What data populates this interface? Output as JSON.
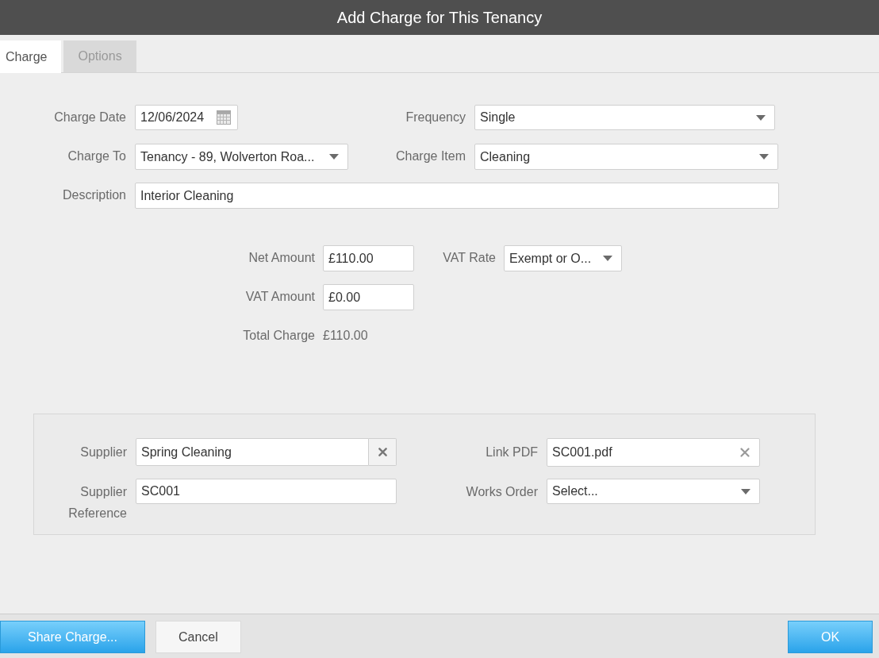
{
  "window": {
    "title": "Add Charge for This Tenancy"
  },
  "tabs": [
    {
      "label": "Charge",
      "selected": true
    },
    {
      "label": "Options",
      "selected": false
    }
  ],
  "charge_details": {
    "charge_date": {
      "label": "Charge Date",
      "value": "12/06/2024"
    },
    "frequency": {
      "label": "Frequency",
      "value": "Single"
    },
    "charge_to": {
      "label": "Charge To",
      "value": "Tenancy - 89, Wolverton Roa..."
    },
    "charge_item": {
      "label": "Charge Item",
      "value": "Cleaning"
    },
    "description": {
      "label": "Description",
      "value": "Interior Cleaning"
    }
  },
  "amounts": {
    "net_amount": {
      "label": "Net Amount",
      "value": "£110.00"
    },
    "vat_rate": {
      "label": "VAT Rate",
      "value": "Exempt or O..."
    },
    "vat_amount": {
      "label": "VAT Amount",
      "value": "£0.00"
    },
    "total_charge": {
      "label": "Total Charge",
      "value": "£110.00"
    }
  },
  "supplier_panel": {
    "supplier": {
      "label": "Supplier",
      "value": "Spring Cleaning"
    },
    "link_pdf": {
      "label": "Link PDF",
      "value": "SC001.pdf"
    },
    "supplier_reference": {
      "label": "Supplier Reference",
      "value": "SC001"
    },
    "works_order": {
      "label": "Works Order",
      "value": "Select..."
    }
  },
  "footer": {
    "left_buttons": [
      {
        "label": "Share Charge...",
        "kind": "primary"
      },
      {
        "label": "Cancel",
        "kind": "secondary"
      }
    ],
    "right_buttons": [
      {
        "label": "OK",
        "kind": "primary"
      }
    ]
  }
}
